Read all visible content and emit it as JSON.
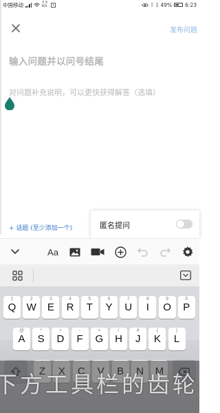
{
  "status_bar": {
    "carrier": "中国移动",
    "net_speed": "7.3 K/s",
    "battery_percent": "49%",
    "time": "6:23"
  },
  "header": {
    "close_icon": "close-icon",
    "publish_label": "发布问题",
    "publish_color": "#8fb6e6"
  },
  "editor": {
    "title_placeholder": "输入问题并以问号结尾",
    "desc_placeholder": "对问题补充说明，可以更快获得解答（选填）",
    "cursor_color": "#1a7e6e"
  },
  "topic": {
    "link_label": "+ 话题 (至少添加一个)",
    "color": "#3a78cf"
  },
  "anonymous": {
    "label": "匿名提问",
    "enabled": false
  },
  "toolbar": {
    "items": [
      "chevron-down-icon",
      "text-format",
      "image-icon",
      "video-icon",
      "add-circle-icon",
      "undo-icon",
      "redo-icon",
      "settings-icon"
    ],
    "font_label": "Aa"
  },
  "keyboard": {
    "row1": [
      {
        "ch": "Q",
        "hint": "1"
      },
      {
        "ch": "W",
        "hint": "2"
      },
      {
        "ch": "E",
        "hint": "3"
      },
      {
        "ch": "R",
        "hint": "4"
      },
      {
        "ch": "T",
        "hint": "5"
      },
      {
        "ch": "Y",
        "hint": "6"
      },
      {
        "ch": "U",
        "hint": "7"
      },
      {
        "ch": "I",
        "hint": "8"
      },
      {
        "ch": "O",
        "hint": "9"
      },
      {
        "ch": "P",
        "hint": "0"
      }
    ],
    "row2": [
      {
        "ch": "A",
        "hint": "@"
      },
      {
        "ch": "S",
        "hint": "*"
      },
      {
        "ch": "D",
        "hint": "+"
      },
      {
        "ch": "F",
        "hint": "-"
      },
      {
        "ch": "G",
        "hint": "="
      },
      {
        "ch": "H",
        "hint": "/"
      },
      {
        "ch": "J",
        "hint": "#"
      },
      {
        "ch": "K",
        "hint": "("
      },
      {
        "ch": "L",
        "hint": ")"
      }
    ],
    "row3": [
      {
        "ch": "Z",
        "hint": "'"
      },
      {
        "ch": "X",
        "hint": ""
      },
      {
        "ch": "C",
        "hint": ""
      },
      {
        "ch": "V",
        "hint": ""
      },
      {
        "ch": "B",
        "hint": ""
      },
      {
        "ch": "N",
        "hint": ""
      },
      {
        "ch": "M",
        "hint": ""
      }
    ]
  },
  "subtitle": "下方工具栏的齿轮"
}
